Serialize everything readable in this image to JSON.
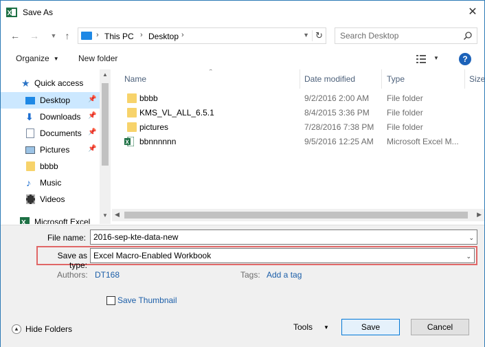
{
  "window": {
    "title": "Save As",
    "close": "✕"
  },
  "nav": {
    "breadcrumbs": [
      "This PC",
      "Desktop"
    ],
    "search_placeholder": "Search Desktop"
  },
  "toolbar": {
    "organize": "Organize",
    "new_folder": "New folder",
    "help": "?"
  },
  "sidebar": {
    "items": [
      {
        "label": "Quick access",
        "pinned": false,
        "selected": false
      },
      {
        "label": "Desktop",
        "pinned": true,
        "selected": true
      },
      {
        "label": "Downloads",
        "pinned": true,
        "selected": false
      },
      {
        "label": "Documents",
        "pinned": true,
        "selected": false
      },
      {
        "label": "Pictures",
        "pinned": true,
        "selected": false
      },
      {
        "label": "bbbb",
        "pinned": false,
        "selected": false
      },
      {
        "label": "Music",
        "pinned": false,
        "selected": false
      },
      {
        "label": "Videos",
        "pinned": false,
        "selected": false
      },
      {
        "label": "Microsoft Excel",
        "pinned": false,
        "selected": false
      }
    ]
  },
  "filelist": {
    "columns": [
      "Name",
      "Date modified",
      "Type",
      "Size"
    ],
    "rows": [
      {
        "name": "bbbb",
        "date": "9/2/2016 2:00 AM",
        "type": "File folder",
        "icon": "folder-icon"
      },
      {
        "name": "KMS_VL_ALL_6.5.1",
        "date": "8/4/2015 3:36 PM",
        "type": "File folder",
        "icon": "folder-icon"
      },
      {
        "name": "pictures",
        "date": "7/28/2016 7:38 PM",
        "type": "File folder",
        "icon": "folder-icon"
      },
      {
        "name": "bbnnnnnn",
        "date": "9/5/2016 12:25 AM",
        "type": "Microsoft Excel M...",
        "icon": "excel-file-icon"
      }
    ]
  },
  "form": {
    "file_name_label": "File name:",
    "file_name_value": "2016-sep-kte-data-new",
    "save_type_label": "Save as type:",
    "save_type_value": "Excel Macro-Enabled Workbook",
    "authors_label": "Authors:",
    "authors_value": "DT168",
    "tags_label": "Tags:",
    "tags_value": "Add a tag",
    "thumbnail_label": "Save Thumbnail"
  },
  "footer": {
    "hide_folders": "Hide Folders",
    "tools": "Tools",
    "save": "Save",
    "cancel": "Cancel"
  },
  "colors": {
    "selection": "#cce8ff",
    "accent": "#0078d7",
    "highlight_border": "#e06666",
    "excel_green": "#1d7044"
  }
}
